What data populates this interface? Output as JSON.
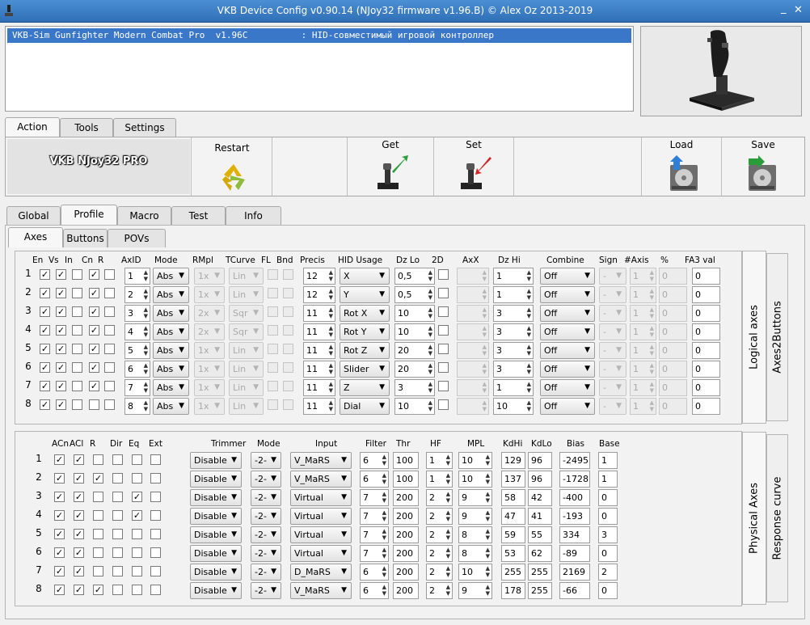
{
  "window": {
    "title": "VKB Device Config v0.90.14 (NJoy32 firmware v1.96.B) © Alex Oz 2013-2019",
    "minimize": "_",
    "close": "✕"
  },
  "device_list": {
    "row": "VKB-Sim Gunfighter Modern Combat Pro  v1.96C          : HID-совместимый игровой контроллер"
  },
  "main_tabs": [
    "Action",
    "Tools",
    "Settings"
  ],
  "toolbar": {
    "device_name": "VKB NJoy32 PRO",
    "restart": "Restart",
    "get": "Get",
    "set": "Set",
    "load": "Load",
    "save": "Save"
  },
  "sub_tabs": [
    "Global",
    "Profile",
    "Macro",
    "Test",
    "Info"
  ],
  "inner_tabs": [
    "Axes",
    "Buttons",
    "POVs"
  ],
  "logical_axes": {
    "side_tabs": [
      "Logical axes",
      "Axes2Buttons"
    ],
    "headers": [
      "En",
      "Vs",
      "In",
      "Cn",
      "R",
      "AxID",
      "Mode",
      "RMpl",
      "TCurve",
      "FL",
      "Bnd",
      "Precis",
      "HID Usage",
      "Dz Lo",
      "2D",
      "AxX",
      "Dz Hi",
      "Combine",
      "Sign",
      "#Axis",
      "%",
      "FA3 val"
    ],
    "rows": [
      {
        "n": "1",
        "en": true,
        "vs": true,
        "in": false,
        "cn": true,
        "r": false,
        "axid": "1",
        "mode": "Abs",
        "rmpl": "1x",
        "tcurve": "Lin",
        "precis": "12",
        "hid": "X",
        "dzlo": "0,5",
        "dzhi": "1",
        "combine": "Off",
        "sign": "-",
        "axis": "1",
        "pct": "0",
        "fa3": "0"
      },
      {
        "n": "2",
        "en": true,
        "vs": true,
        "in": false,
        "cn": true,
        "r": false,
        "axid": "2",
        "mode": "Abs",
        "rmpl": "1x",
        "tcurve": "Lin",
        "precis": "12",
        "hid": "Y",
        "dzlo": "0,5",
        "dzhi": "1",
        "combine": "Off",
        "sign": "-",
        "axis": "1",
        "pct": "0",
        "fa3": "0"
      },
      {
        "n": "3",
        "en": true,
        "vs": true,
        "in": false,
        "cn": true,
        "r": false,
        "axid": "3",
        "mode": "Abs",
        "rmpl": "2x",
        "tcurve": "Sqr",
        "precis": "11",
        "hid": "Rot X",
        "dzlo": "10",
        "dzhi": "3",
        "combine": "Off",
        "sign": "-",
        "axis": "1",
        "pct": "0",
        "fa3": "0"
      },
      {
        "n": "4",
        "en": true,
        "vs": true,
        "in": false,
        "cn": true,
        "r": false,
        "axid": "4",
        "mode": "Abs",
        "rmpl": "2x",
        "tcurve": "Sqr",
        "precis": "11",
        "hid": "Rot Y",
        "dzlo": "10",
        "dzhi": "3",
        "combine": "Off",
        "sign": "-",
        "axis": "1",
        "pct": "0",
        "fa3": "0"
      },
      {
        "n": "5",
        "en": true,
        "vs": true,
        "in": false,
        "cn": true,
        "r": false,
        "axid": "5",
        "mode": "Abs",
        "rmpl": "1x",
        "tcurve": "Lin",
        "precis": "11",
        "hid": "Rot Z",
        "dzlo": "20",
        "dzhi": "3",
        "combine": "Off",
        "sign": "-",
        "axis": "1",
        "pct": "0",
        "fa3": "0"
      },
      {
        "n": "6",
        "en": true,
        "vs": true,
        "in": false,
        "cn": true,
        "r": false,
        "axid": "6",
        "mode": "Abs",
        "rmpl": "1x",
        "tcurve": "Lin",
        "precis": "11",
        "hid": "Slider",
        "dzlo": "20",
        "dzhi": "3",
        "combine": "Off",
        "sign": "-",
        "axis": "1",
        "pct": "0",
        "fa3": "0"
      },
      {
        "n": "7",
        "en": true,
        "vs": true,
        "in": false,
        "cn": true,
        "r": false,
        "axid": "7",
        "mode": "Abs",
        "rmpl": "1x",
        "tcurve": "Lin",
        "precis": "11",
        "hid": "Z",
        "dzlo": "3",
        "dzhi": "1",
        "combine": "Off",
        "sign": "-",
        "axis": "1",
        "pct": "0",
        "fa3": "0"
      },
      {
        "n": "8",
        "en": true,
        "vs": true,
        "in": false,
        "cn": false,
        "r": false,
        "axid": "8",
        "mode": "Abs",
        "rmpl": "1x",
        "tcurve": "Lin",
        "precis": "11",
        "hid": "Dial",
        "dzlo": "10",
        "dzhi": "10",
        "combine": "Off",
        "sign": "-",
        "axis": "1",
        "pct": "0",
        "fa3": "0"
      }
    ]
  },
  "physical_axes": {
    "side_tabs": [
      "Physical Axes",
      "Response curve"
    ],
    "headers": [
      "ACn",
      "ACl",
      "R",
      "Dir",
      "Eq",
      "Ext",
      "Trimmer",
      "Mode",
      "Input",
      "Filter",
      "Thr",
      "HF",
      "MPL",
      "KdHi",
      "KdLo",
      "Bias",
      "Base"
    ],
    "rows": [
      {
        "n": "1",
        "acn": true,
        "acl": true,
        "r": false,
        "dir": false,
        "eq": false,
        "ext": false,
        "trimmer": "Disable",
        "mode": "-2-",
        "input": "V_MaRS",
        "filter": "6",
        "thr": "100",
        "hf": "1",
        "mpl": "10",
        "kdhi": "129",
        "kdlo": "96",
        "bias": "-2495",
        "base": "1"
      },
      {
        "n": "2",
        "acn": true,
        "acl": true,
        "r": true,
        "dir": false,
        "eq": false,
        "ext": false,
        "trimmer": "Disable",
        "mode": "-2-",
        "input": "V_MaRS",
        "filter": "6",
        "thr": "100",
        "hf": "1",
        "mpl": "10",
        "kdhi": "137",
        "kdlo": "96",
        "bias": "-1728",
        "base": "1"
      },
      {
        "n": "3",
        "acn": true,
        "acl": true,
        "r": false,
        "dir": false,
        "eq": true,
        "ext": false,
        "trimmer": "Disable",
        "mode": "-2-",
        "input": "Virtual",
        "filter": "7",
        "thr": "200",
        "hf": "2",
        "mpl": "9",
        "kdhi": "58",
        "kdlo": "42",
        "bias": "-400",
        "base": "0"
      },
      {
        "n": "4",
        "acn": true,
        "acl": true,
        "r": false,
        "dir": false,
        "eq": true,
        "ext": false,
        "trimmer": "Disable",
        "mode": "-2-",
        "input": "Virtual",
        "filter": "7",
        "thr": "200",
        "hf": "2",
        "mpl": "9",
        "kdhi": "47",
        "kdlo": "41",
        "bias": "-193",
        "base": "0"
      },
      {
        "n": "5",
        "acn": true,
        "acl": true,
        "r": false,
        "dir": false,
        "eq": false,
        "ext": false,
        "trimmer": "Disable",
        "mode": "-2-",
        "input": "Virtual",
        "filter": "7",
        "thr": "200",
        "hf": "2",
        "mpl": "8",
        "kdhi": "59",
        "kdlo": "55",
        "bias": "334",
        "base": "3"
      },
      {
        "n": "6",
        "acn": true,
        "acl": true,
        "r": false,
        "dir": false,
        "eq": false,
        "ext": false,
        "trimmer": "Disable",
        "mode": "-2-",
        "input": "Virtual",
        "filter": "7",
        "thr": "200",
        "hf": "2",
        "mpl": "8",
        "kdhi": "53",
        "kdlo": "62",
        "bias": "-89",
        "base": "0"
      },
      {
        "n": "7",
        "acn": true,
        "acl": true,
        "r": false,
        "dir": false,
        "eq": false,
        "ext": false,
        "trimmer": "Disable",
        "mode": "-2-",
        "input": "D_MaRS",
        "filter": "6",
        "thr": "200",
        "hf": "2",
        "mpl": "10",
        "kdhi": "255",
        "kdlo": "255",
        "bias": "2169",
        "base": "2"
      },
      {
        "n": "8",
        "acn": true,
        "acl": true,
        "r": true,
        "dir": false,
        "eq": false,
        "ext": false,
        "trimmer": "Disable",
        "mode": "-2-",
        "input": "V_MaRS",
        "filter": "6",
        "thr": "200",
        "hf": "2",
        "mpl": "9",
        "kdhi": "178",
        "kdlo": "255",
        "bias": "-66",
        "base": "0"
      }
    ]
  },
  "glyphs": {
    "check": "✓",
    "spin_up": "▲",
    "spin_down": "▼",
    "dropdown": "▼"
  }
}
